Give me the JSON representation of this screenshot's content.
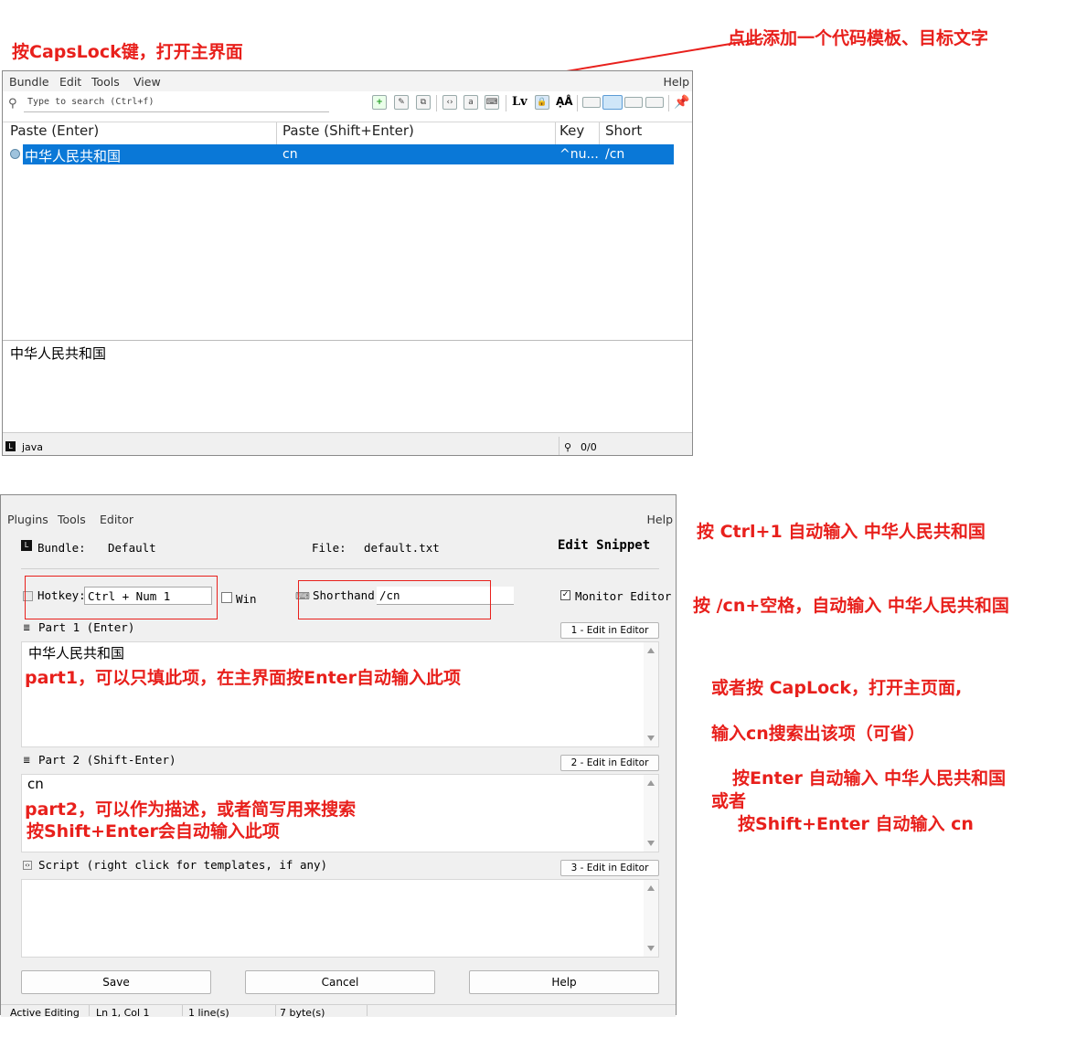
{
  "annotations": {
    "open_main": "按CapsLock键，打开主界面",
    "add_template": "点此添加一个代码模板、目标文字",
    "hotkey_tip": "按 Ctrl+1 自动输入 中华人民共和国",
    "shorthand_tip": "按 /cn+空格，自动输入 中华人民共和国",
    "or_caplock": "或者按  CapLock，打开主页面,",
    "search_tip": "输入cn搜索出该项（可省）",
    "enter_tip": "按Enter 自动输入 中华人民共和国",
    "or": "或者",
    "shift_enter_tip": "按Shift+Enter 自动输入 cn",
    "part1_note": "part1，可以只填此项，在主界面按Enter自动输入此项",
    "part2_note_line1": "part2，可以作为描述，或者简写用来搜索",
    "part2_note_line2": "按Shift+Enter会自动输入此项"
  },
  "main_window": {
    "menu": [
      "Bundle",
      "Edit",
      "Tools",
      "View"
    ],
    "help": "Help",
    "search_placeholder": "Type to search (Ctrl+f)",
    "columns": [
      "Paste (Enter)",
      "Paste (Shift+Enter)",
      "Key",
      "Short"
    ],
    "row": {
      "paste": "中华人民共和国",
      "paste_shift": "cn",
      "key": "^nu...",
      "short": "/cn"
    },
    "preview": "中华人民共和国",
    "status_left": "java",
    "status_right": "0/0",
    "toolbar_lv": "Lv"
  },
  "editor_window": {
    "menu": [
      "Plugins",
      "Tools",
      "Editor"
    ],
    "help": "Help",
    "bundle_label": "Bundle:",
    "bundle_value": "Default",
    "file_label": "File:",
    "file_value": "default.txt",
    "title": "Edit Snippet",
    "hotkey_label": "Hotkey:",
    "hotkey_value": "Ctrl + Num 1",
    "win_label": "Win",
    "shorthand_label": "Shorthand:",
    "shorthand_value": "/cn",
    "monitor_label": "Monitor Editor",
    "part1_label": "Part 1 (Enter)",
    "part1_btn": "1 - Edit in Editor",
    "part1_text": "中华人民共和国",
    "part2_label": "Part 2 (Shift-Enter)",
    "part2_btn": "2 - Edit in Editor",
    "part2_text": "cn",
    "script_label": "Script (right click for templates, if any)",
    "script_btn": "3 - Edit in Editor",
    "save": "Save",
    "cancel": "Cancel",
    "helpbtn": "Help",
    "status": [
      "Active Editing",
      "Ln 1, Col 1",
      "1 line(s)",
      "7 byte(s)"
    ]
  },
  "colors": {
    "annotation_red": "#e8201c",
    "selection_blue": "#0a78d7"
  }
}
